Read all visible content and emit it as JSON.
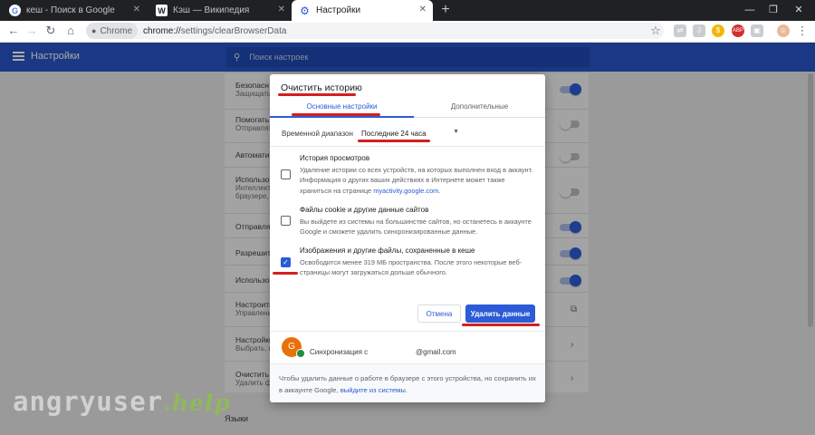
{
  "browser": {
    "tabs": [
      {
        "title": "кеш - Поиск в Google",
        "icon": "G"
      },
      {
        "title": "Кэш — Википедия",
        "icon": "W"
      },
      {
        "title": "Настройки",
        "icon": "⚙"
      }
    ],
    "chip": "Chrome",
    "url_host": "chrome://",
    "url_path": "settings/clearBrowserData",
    "icons": [
      "back-icon",
      "forward-icon",
      "reload-icon",
      "home-icon",
      "star-icon",
      "extension-icon",
      "avatar-icon",
      "menu-icon"
    ]
  },
  "settings": {
    "title": "Настройки",
    "search_placeholder": "Поиск настроек",
    "rows": [
      {
        "title": "Безопасн",
        "sub": "Защищать",
        "toggle": "on"
      },
      {
        "title": "Помогать",
        "sub": "Отправлят",
        "toggle": "off"
      },
      {
        "title": "Автоматич",
        "sub": "",
        "toggle": "off"
      },
      {
        "title": "Использо",
        "sub": "Интеллект",
        "sub2": "браузере, а",
        "toggle": "off"
      },
      {
        "title": "Отправлят",
        "sub": "",
        "toggle": "on"
      },
      {
        "title": "Разрешит",
        "sub": "",
        "toggle": "on"
      },
      {
        "title": "Использо",
        "sub": "",
        "toggle": "on"
      },
      {
        "title": "Настроить",
        "sub": "Управлени",
        "toggle": "link"
      },
      {
        "title": "Настройки",
        "sub": "Выбрать, к",
        "toggle": "arrow"
      },
      {
        "title": "Очистить и",
        "sub": "Удалить фа",
        "toggle": "arrow"
      }
    ],
    "section_languages": "Языки"
  },
  "dialog": {
    "title": "Очистить историю",
    "tab_basic": "Основные настройки",
    "tab_advanced": "Дополнительные",
    "range_label": "Временной диапазон",
    "range_value": "Последние 24 часа",
    "options": [
      {
        "title": "История просмотров",
        "desc": "Удаление истории со всех устройств, на которых выполнен вход в аккаунт. Информация о других ваших действиях в Интернете может также храниться на странице ",
        "link": "myactivity.google.com",
        "tail": ".",
        "checked": false
      },
      {
        "title": "Файлы cookie и другие данные сайтов",
        "desc": "Вы выйдете из системы на большинстве сайтов, но останетесь в аккаунте Google и сможете удалить синхронизированные данные.",
        "checked": false
      },
      {
        "title": "Изображения и другие файлы, сохраненные в кеше",
        "desc": "Освободится менее 319 МБ пространства. После этого некоторые веб-страницы могут загружаться дольше обычного.",
        "checked": true
      }
    ],
    "cancel": "Отмена",
    "confirm": "Удалить данные",
    "avatar_letter": "G",
    "sync_label": "Синхронизация с",
    "email": "@gmail.com",
    "footer_text": "Чтобы удалить данные о работе в браузере с этого устройства, но сохранить их в аккаунте Google, ",
    "footer_link": "выйдите из системы",
    "footer_tail": ".",
    "accent": "#2b5bd7",
    "marker_color": "#d21f1f"
  },
  "watermark": {
    "main": "angryuser",
    "help": ".help"
  }
}
